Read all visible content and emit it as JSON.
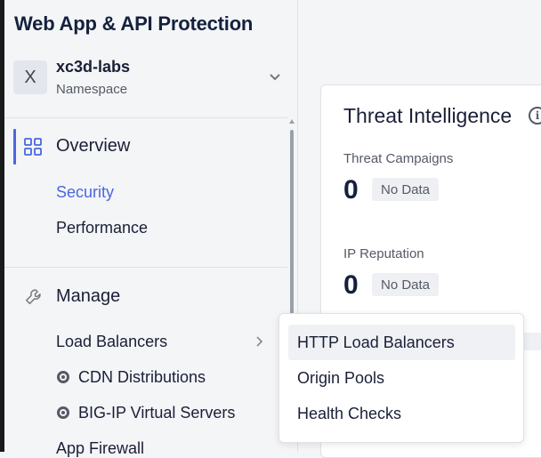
{
  "app": {
    "title": "Web App & API Protection"
  },
  "namespace": {
    "avatar_letter": "X",
    "name": "xc3d-labs",
    "label": "Namespace"
  },
  "sidebar": {
    "overview": {
      "title": "Overview",
      "items": [
        {
          "label": "Security",
          "active": true
        },
        {
          "label": "Performance"
        }
      ]
    },
    "manage": {
      "title": "Manage",
      "items": [
        {
          "label": "Load Balancers"
        },
        {
          "label": "CDN Distributions"
        },
        {
          "label": "BIG-IP Virtual Servers"
        },
        {
          "label": "App Firewall"
        }
      ]
    }
  },
  "main": {
    "card": {
      "title": "Threat Intelligence",
      "metrics": [
        {
          "label": "Threat Campaigns",
          "value": "0",
          "badge": "No Data"
        },
        {
          "label": "IP Reputation",
          "value": "0",
          "badge": "No Data"
        }
      ]
    }
  },
  "dropdown": {
    "items": [
      {
        "label": "HTTP Load Balancers",
        "hovered": true
      },
      {
        "label": "Origin Pools"
      },
      {
        "label": "Health Checks"
      }
    ]
  },
  "colors": {
    "accent": "#4a66e0",
    "title": "#14213d",
    "text": "#1a1f36",
    "muted": "#555a66"
  }
}
